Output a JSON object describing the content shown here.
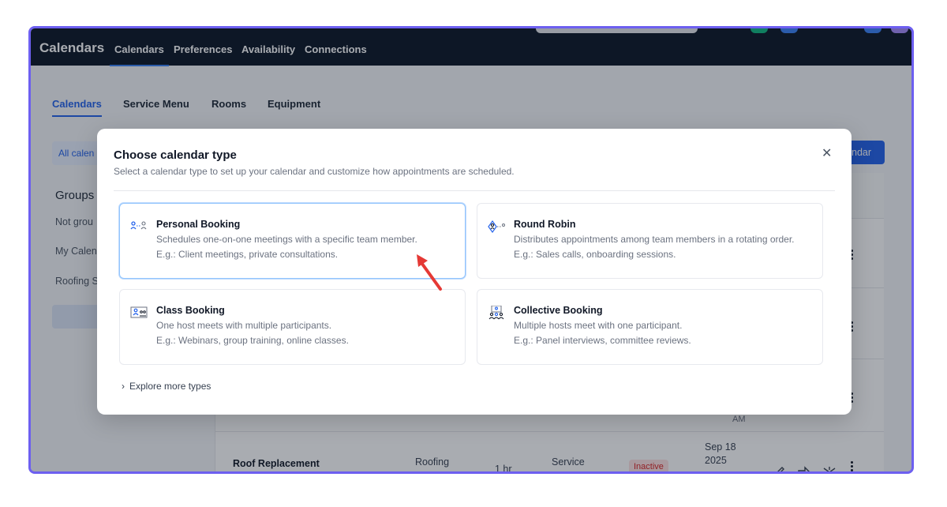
{
  "app": {
    "brand": "Calendars",
    "top_nav": [
      "Calendars",
      "Preferences",
      "Availability",
      "Connections"
    ]
  },
  "sub_nav": [
    "Calendars",
    "Service Menu",
    "Rooms",
    "Equipment"
  ],
  "sidebar": {
    "filter_chip": "All calen",
    "groups_heading": "Groups",
    "items": [
      "Not grou",
      "My Calen",
      "Roofing S"
    ]
  },
  "new_calendar_button": "ndar",
  "table_row": {
    "name": "Roof Replacement",
    "group": "Roofing",
    "duration": "1 hr",
    "type": "Service",
    "status": "Inactive",
    "date_lines": [
      "Sep 18",
      "2025"
    ],
    "time_fragment": "AM"
  },
  "modal": {
    "title": "Choose calendar type",
    "subtitle": "Select a calendar type to set up your calendar and customize how appointments are scheduled.",
    "close_icon": "close-icon",
    "explore_label": "Explore more types",
    "cards": [
      {
        "title": "Personal Booking",
        "desc": "Schedules one-on-one meetings with a specific team member.",
        "example": "E.g.: Client meetings, private consultations.",
        "icon": "personal-booking-icon",
        "selected": true
      },
      {
        "title": "Round Robin",
        "desc": "Distributes appointments among team members in a rotating order.",
        "example": "E.g.: Sales calls, onboarding sessions.",
        "icon": "round-robin-icon",
        "selected": false
      },
      {
        "title": "Class Booking",
        "desc": "One host meets with multiple participants.",
        "example": "E.g.: Webinars, group training, online classes.",
        "icon": "class-booking-icon",
        "selected": false
      },
      {
        "title": "Collective Booking",
        "desc": "Multiple hosts meet with one participant.",
        "example": "E.g.: Panel interviews, committee reviews.",
        "icon": "collective-booking-icon",
        "selected": false
      }
    ]
  },
  "colors": {
    "accent": "#2563eb",
    "topbar": "#0b1626",
    "frame_border": "#6d5ff0",
    "annotation_arrow": "#e53935",
    "inactive_badge": "#dc2626"
  }
}
